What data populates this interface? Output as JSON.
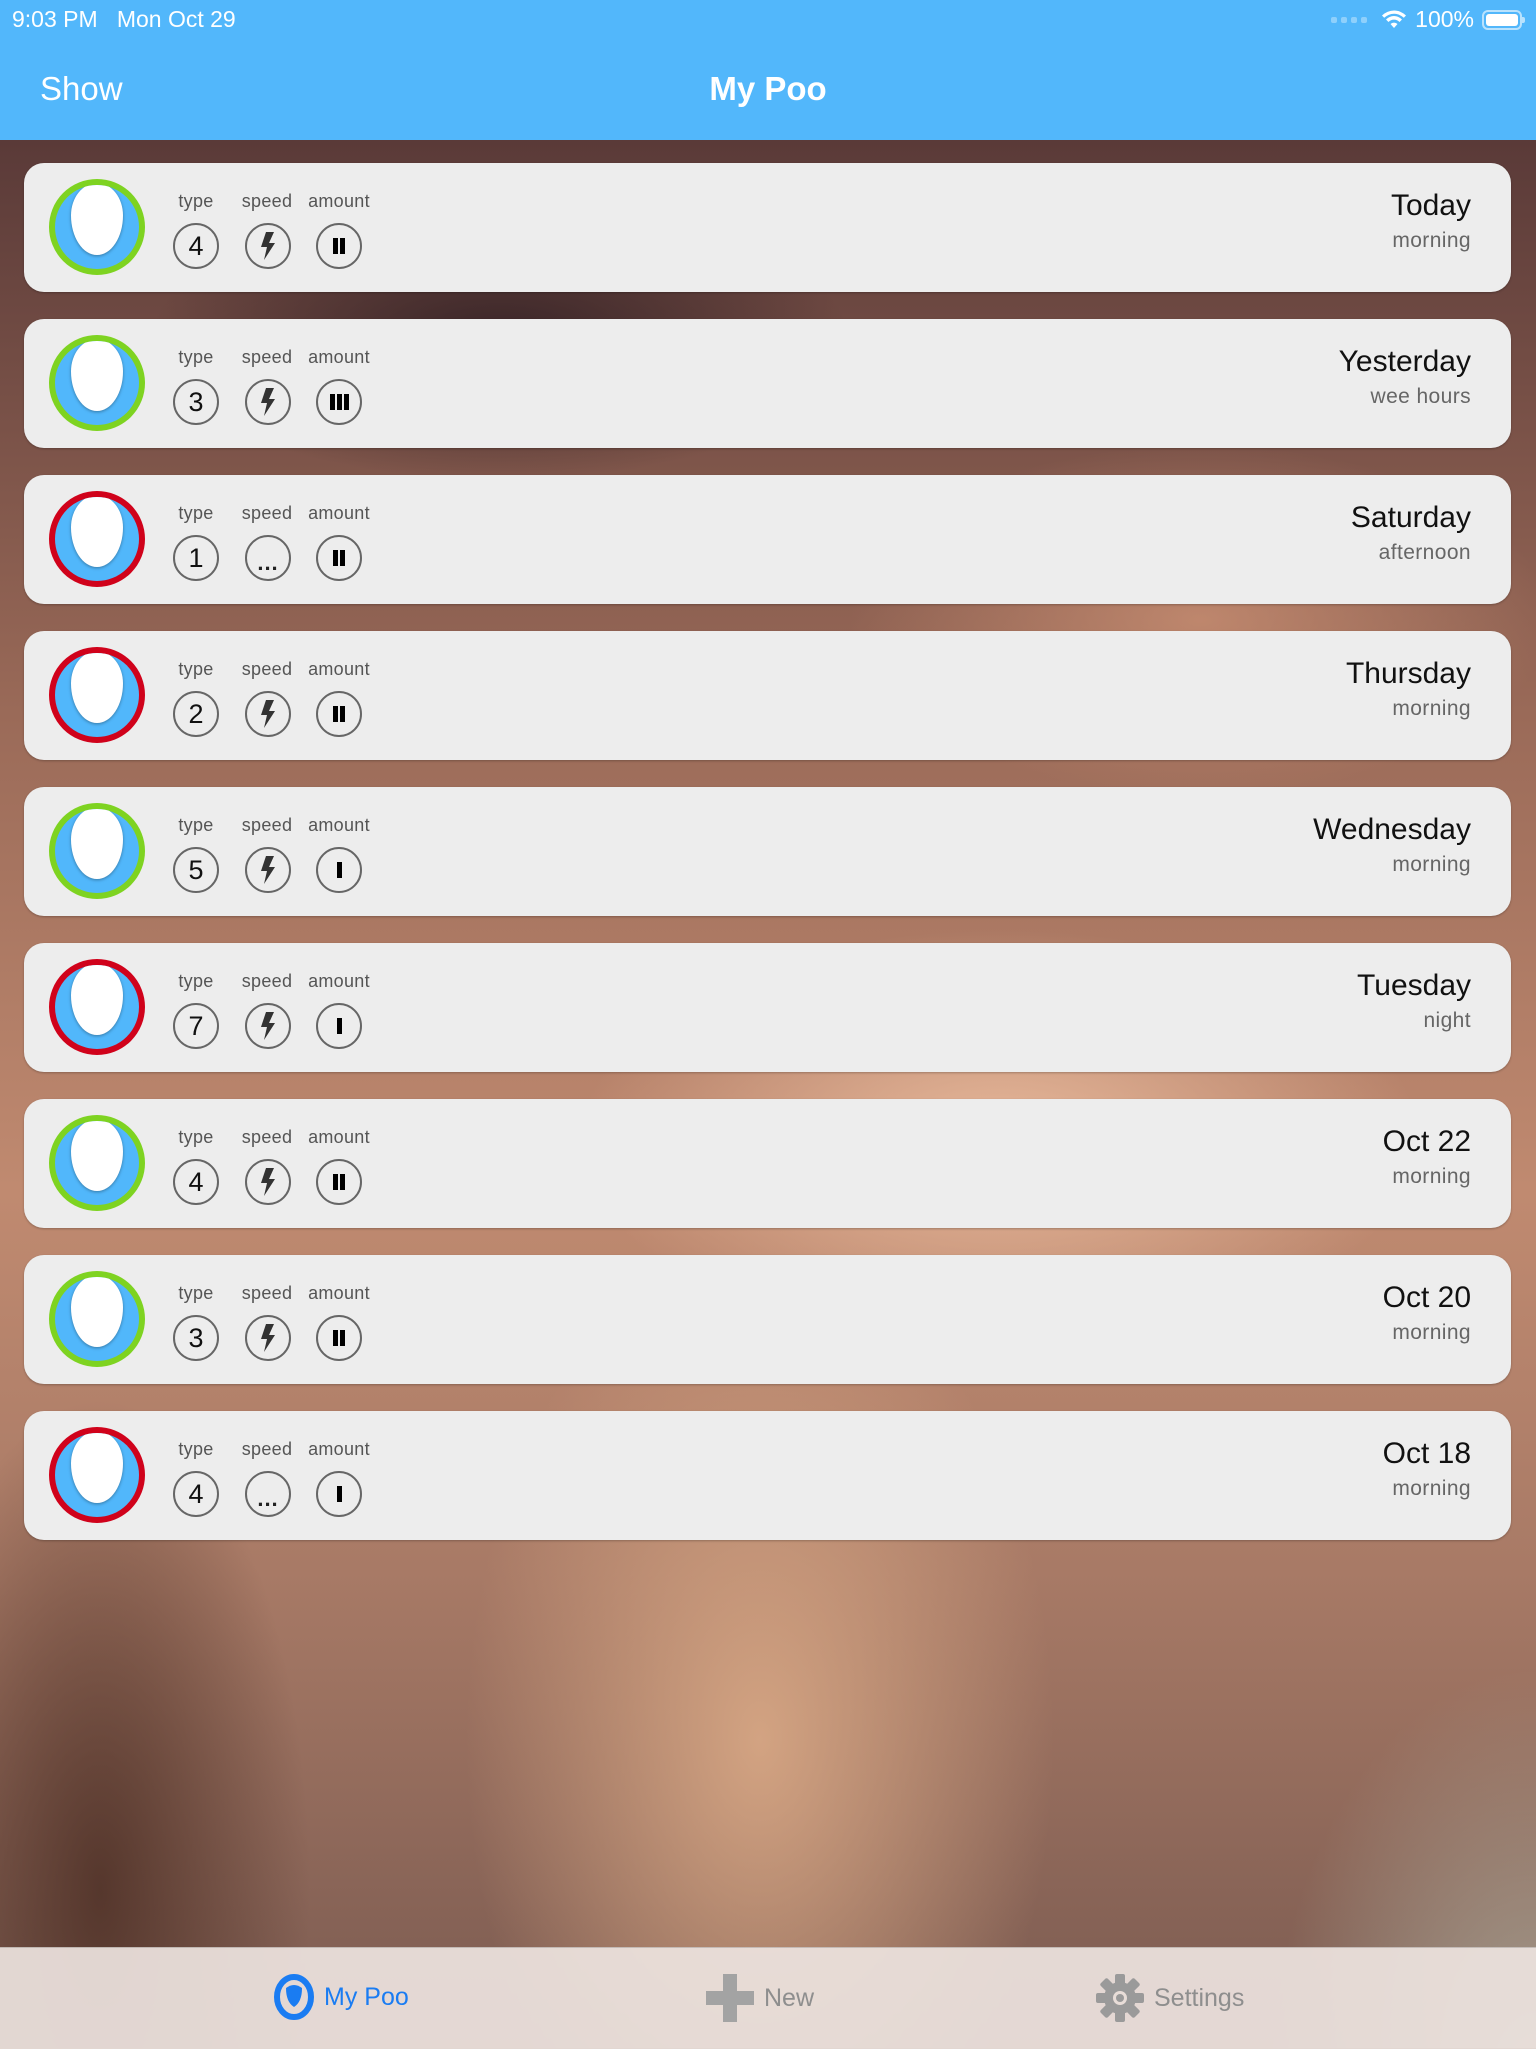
{
  "status_bar": {
    "time": "9:03 PM",
    "date": "Mon Oct 29",
    "battery": "100%",
    "battery_level": 1.0,
    "icons": [
      "signal-dots-icon",
      "wifi-icon",
      "battery-icon"
    ]
  },
  "nav": {
    "left_button": "Show",
    "title": "My Poo"
  },
  "labels": {
    "type": "type",
    "speed": "speed",
    "amount": "amount"
  },
  "colors": {
    "accent": "#52b7fb",
    "good": "#7ed321",
    "bad": "#d0021b",
    "tab_active": "#1a7cf2",
    "tab_inactive": "#8e8e8e"
  },
  "entries": [
    {
      "status": "good",
      "type": "4",
      "speed": "fast",
      "amount": 2,
      "day": "Today",
      "part": "morning"
    },
    {
      "status": "good",
      "type": "3",
      "speed": "fast",
      "amount": 3,
      "day": "Yesterday",
      "part": "wee hours"
    },
    {
      "status": "bad",
      "type": "1",
      "speed": "slow",
      "amount": 2,
      "day": "Saturday",
      "part": "afternoon"
    },
    {
      "status": "bad",
      "type": "2",
      "speed": "fast",
      "amount": 2,
      "day": "Thursday",
      "part": "morning"
    },
    {
      "status": "good",
      "type": "5",
      "speed": "fast",
      "amount": 1,
      "day": "Wednesday",
      "part": "morning"
    },
    {
      "status": "bad",
      "type": "7",
      "speed": "fast",
      "amount": 1,
      "day": "Tuesday",
      "part": "night"
    },
    {
      "status": "good",
      "type": "4",
      "speed": "fast",
      "amount": 2,
      "day": "Oct 22",
      "part": "morning"
    },
    {
      "status": "good",
      "type": "3",
      "speed": "fast",
      "amount": 2,
      "day": "Oct 20",
      "part": "morning"
    },
    {
      "status": "bad",
      "type": "4",
      "speed": "slow",
      "amount": 1,
      "day": "Oct 18",
      "part": "morning"
    }
  ],
  "tabs": [
    {
      "label": "My Poo",
      "icon": "shield-icon",
      "active": true
    },
    {
      "label": "New",
      "icon": "plus-icon",
      "active": false
    },
    {
      "label": "Settings",
      "icon": "gear-icon",
      "active": false
    }
  ],
  "speed_symbols": {
    "fast": "lightning-icon",
    "slow": "ellipsis-icon"
  },
  "slow_text": "..."
}
